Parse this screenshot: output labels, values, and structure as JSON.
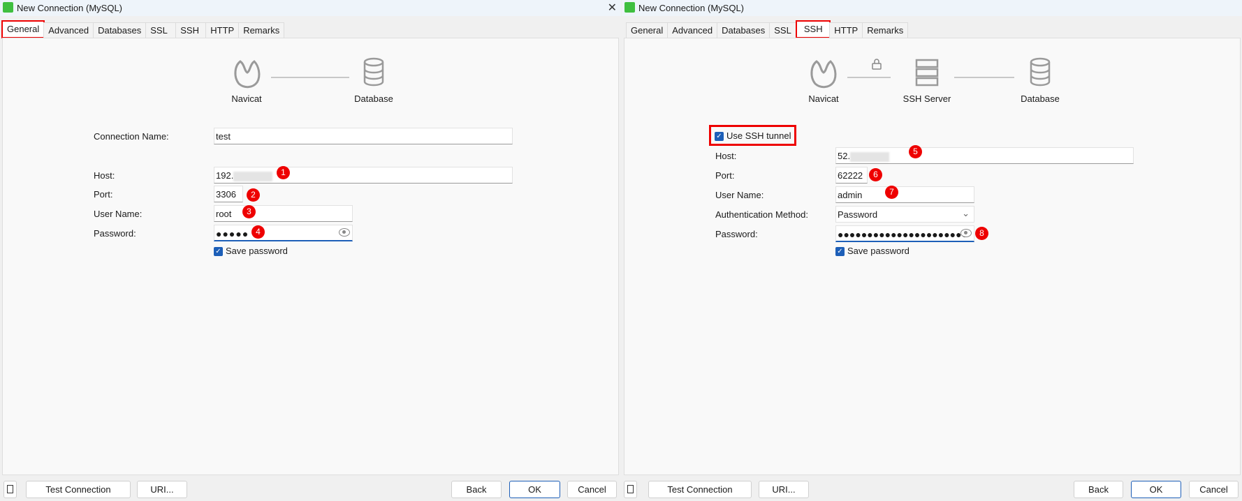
{
  "left": {
    "title": "New Connection (MySQL)",
    "tabs": [
      "General",
      "Advanced",
      "Databases",
      "SSL",
      "SSH",
      "HTTP",
      "Remarks"
    ],
    "diagram": {
      "navicat": "Navicat",
      "database": "Database"
    },
    "fields": {
      "conn_label": "Connection Name:",
      "conn_value": "test",
      "host_label": "Host:",
      "host_value": "192.",
      "port_label": "Port:",
      "port_value": "3306",
      "user_label": "User Name:",
      "user_value": "root",
      "pass_label": "Password:",
      "pass_value": "●●●●●",
      "save_pw": "Save password"
    },
    "badges": [
      "1",
      "2",
      "3",
      "4"
    ]
  },
  "right": {
    "title": "New Connection (MySQL)",
    "tabs": [
      "General",
      "Advanced",
      "Databases",
      "SSL",
      "SSH",
      "HTTP",
      "Remarks"
    ],
    "diagram": {
      "navicat": "Navicat",
      "ssh": "SSH Server",
      "database": "Database"
    },
    "fields": {
      "use_ssh": "Use SSH tunnel",
      "host_label": "Host:",
      "host_value": "52.",
      "port_label": "Port:",
      "port_value": "62222",
      "user_label": "User Name:",
      "user_value": "admin",
      "auth_label": "Authentication Method:",
      "auth_value": "Password",
      "pass_label": "Password:",
      "pass_value": "●●●●●●●●●●●●●●●●●●●●●●",
      "save_pw": "Save password"
    },
    "badges": [
      "5",
      "6",
      "7",
      "8"
    ]
  },
  "buttons": {
    "test": "Test Connection",
    "uri": "URI...",
    "back": "Back",
    "ok": "OK",
    "cancel": "Cancel"
  }
}
